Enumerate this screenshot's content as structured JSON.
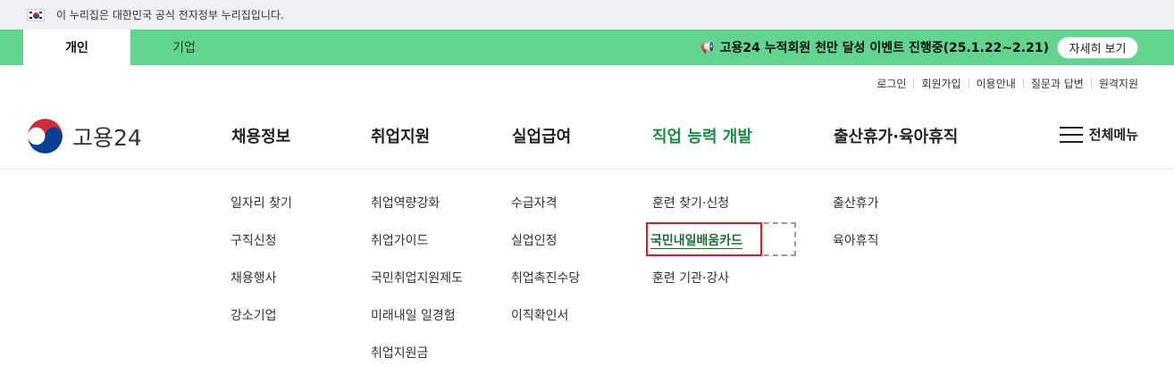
{
  "gov_banner": {
    "text": "이 누리집은 대한민국 공식 전자정부 누리집입니다."
  },
  "topbar": {
    "tabs": [
      "개인",
      "기업"
    ],
    "notice": "고용24 누적회원 천만 달성 이벤트 진행중(25.1.22~2.21)",
    "more_label": "자세히 보기"
  },
  "util_links": [
    "로그인",
    "회원가입",
    "이용안내",
    "질문과 답변",
    "원격지원"
  ],
  "logo": {
    "text": "고용24"
  },
  "gnb": [
    "채용정보",
    "취업지원",
    "실업급여",
    "직업 능력 개발",
    "출산휴가·육아휴직"
  ],
  "all_menu_label": "전체메뉴",
  "submenus": {
    "col1": [
      "일자리 찾기",
      "구직신청",
      "채용행사",
      "강소기업"
    ],
    "col2": [
      "취업역량강화",
      "취업가이드",
      "국민취업지원제도",
      "미래내일 일경험",
      "취업지원금"
    ],
    "col3": [
      "수급자격",
      "실업인정",
      "취업촉진수당",
      "이직확인서"
    ],
    "col4": [
      "훈련 찾기·신청",
      "국민내일배움카드",
      "훈련 기관·강사"
    ],
    "col5": [
      "출산휴가",
      "육아휴직"
    ]
  },
  "colors": {
    "green_bar": "#62d48f",
    "active_nav": "#1f8a45",
    "highlight_box": "#e11b22"
  }
}
